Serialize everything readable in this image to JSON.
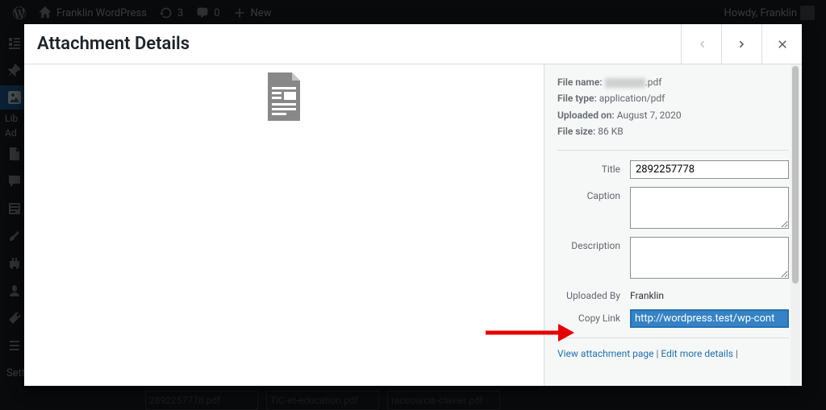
{
  "adminbar": {
    "site_name": "Franklin WordPress",
    "updates": "3",
    "comments": "0",
    "new_label": "New",
    "howdy": "Howdy, Franklin"
  },
  "sidebar": {
    "settings_label": "Settings"
  },
  "modal": {
    "title": "Attachment Details"
  },
  "meta": {
    "filename_label": "File name:",
    "filename_ext": ".pdf",
    "filetype_label": "File type:",
    "filetype": "application/pdf",
    "uploaded_label": "Uploaded on:",
    "uploaded": "August 7, 2020",
    "filesize_label": "File size:",
    "filesize": "86 KB"
  },
  "fields": {
    "title_label": "Title",
    "title_value": "2892257778",
    "caption_label": "Caption",
    "caption_value": "",
    "description_label": "Description",
    "description_value": "",
    "uploaded_by_label": "Uploaded By",
    "uploaded_by": "Franklin",
    "copy_link_label": "Copy Link",
    "copy_link_value": "http://wordpress.test/wp-cont"
  },
  "links": {
    "view": "View attachment page",
    "edit": "Edit more details"
  },
  "bg": {
    "f1": "2892257778.pdf",
    "f2": "TIC-et-education.pdf",
    "f3": "raccourcis-clavier.pdf"
  },
  "truncated": {
    "lib": "Lib",
    "ad": "Ad"
  }
}
